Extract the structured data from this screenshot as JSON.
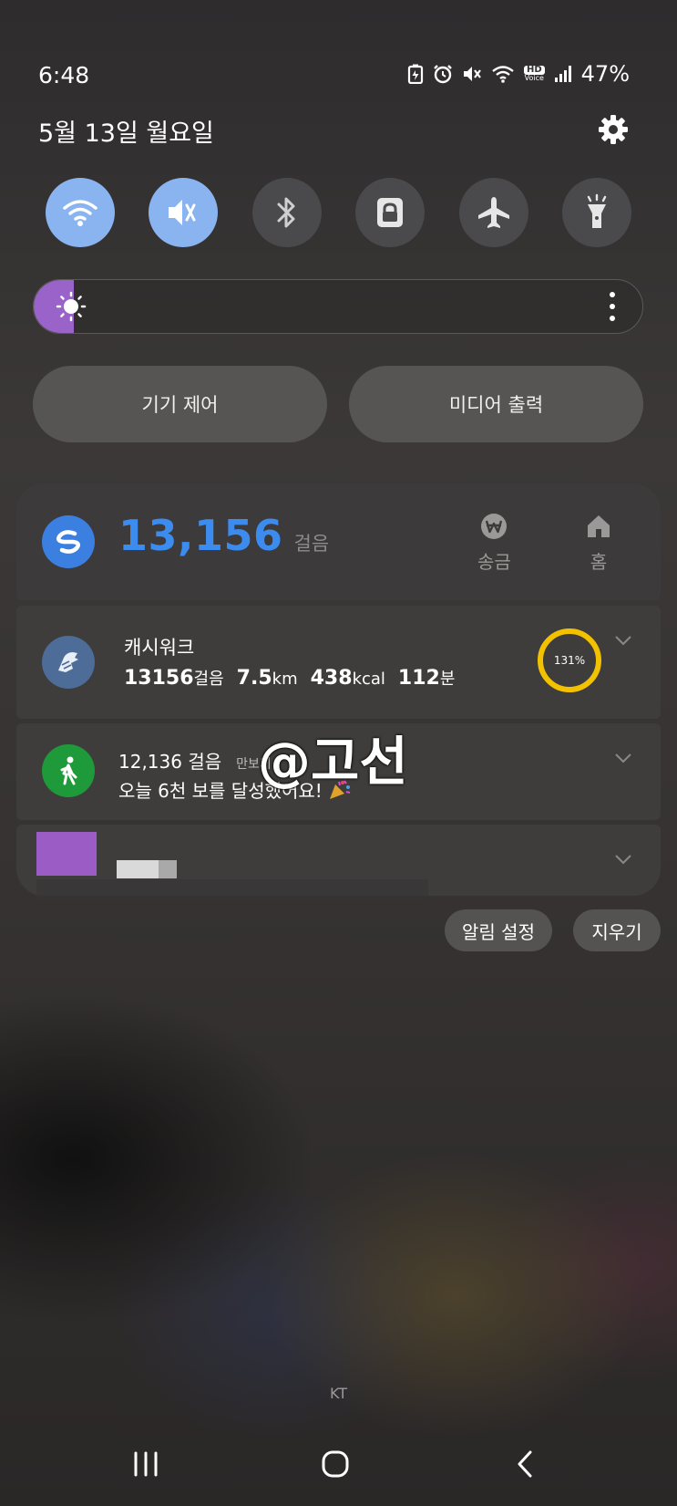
{
  "status_bar": {
    "time": "6:48",
    "battery": "47%",
    "icons": [
      "battery-saver-icon",
      "alarm-icon",
      "mute-icon",
      "wifi-icon",
      "hd-voice-icon",
      "signal-icon"
    ],
    "hd_voice_label": "HD",
    "hd_voice_sub": "Voice"
  },
  "header": {
    "date": "5월 13일 월요일"
  },
  "quick_settings": [
    {
      "name": "wifi",
      "icon": "wifi-icon",
      "on": true
    },
    {
      "name": "sound",
      "icon": "mute-icon",
      "on": true
    },
    {
      "name": "bluetooth",
      "icon": "bluetooth-icon",
      "on": false
    },
    {
      "name": "screen-lock",
      "icon": "lock-icon",
      "on": false
    },
    {
      "name": "airplane",
      "icon": "airplane-icon",
      "on": false
    },
    {
      "name": "flashlight",
      "icon": "flashlight-icon",
      "on": false
    }
  ],
  "brightness": {
    "level": 0.06,
    "accent": "#9a63c9"
  },
  "panel_buttons": {
    "device_control": "기기 제어",
    "media_output": "미디어 출력"
  },
  "step_widget": {
    "steps": "13,156",
    "unit": "걸음",
    "shortcut1": "송금",
    "shortcut2": "홈",
    "accent": "#3c8cf0"
  },
  "cashwalk": {
    "title": "캐시워크",
    "steps_val": "13156",
    "steps_unit": "걸음",
    "dist_val": "7.5",
    "dist_unit": "km",
    "kcal_val": "438",
    "kcal_unit": "kcal",
    "min_val": "112",
    "min_unit": "분",
    "progress_label": "131%",
    "ring_color": "#f2c200"
  },
  "pedometer": {
    "steps": "12,136 걸음",
    "app_name": "만보기",
    "message": "오늘 6천 보를 달성했어요!"
  },
  "watermark": "@고선",
  "actions": {
    "notification_settings": "알림 설정",
    "clear": "지우기"
  },
  "carrier": "KT",
  "nav_bar": [
    "recent-apps-icon",
    "home-icon",
    "back-icon"
  ]
}
